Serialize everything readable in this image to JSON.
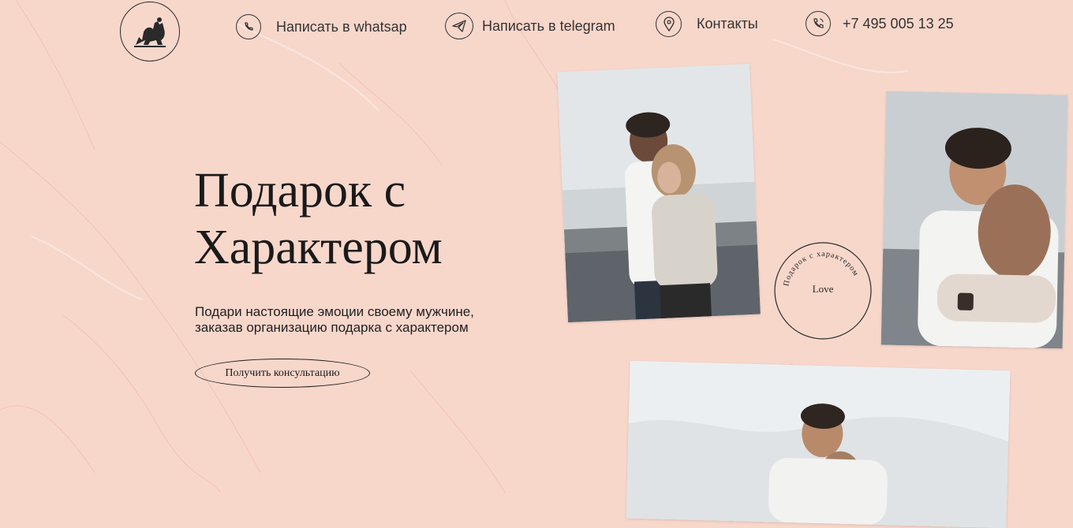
{
  "header": {
    "nav": [
      {
        "icon": "whatsapp-icon",
        "label": "Написать в whatsap"
      },
      {
        "icon": "telegram-icon",
        "label": "Написать в telegram"
      },
      {
        "icon": "location-pin-icon",
        "label": "Контакты"
      },
      {
        "icon": "phone-icon",
        "label": "+7 495 005 13 25"
      }
    ]
  },
  "hero": {
    "title_line1": "Подарок с",
    "title_line2": "Характером",
    "subtitle_line1": "Подари настоящие эмоции своему мужчине,",
    "subtitle_line2": "заказав организацию подарка с характером",
    "cta_label": "Получить консультацию"
  },
  "stamp": {
    "center_text": "Love",
    "ring_text": "Подарок с характером"
  },
  "colors": {
    "background": "#f8d7cb",
    "text": "#1a1a1a"
  }
}
